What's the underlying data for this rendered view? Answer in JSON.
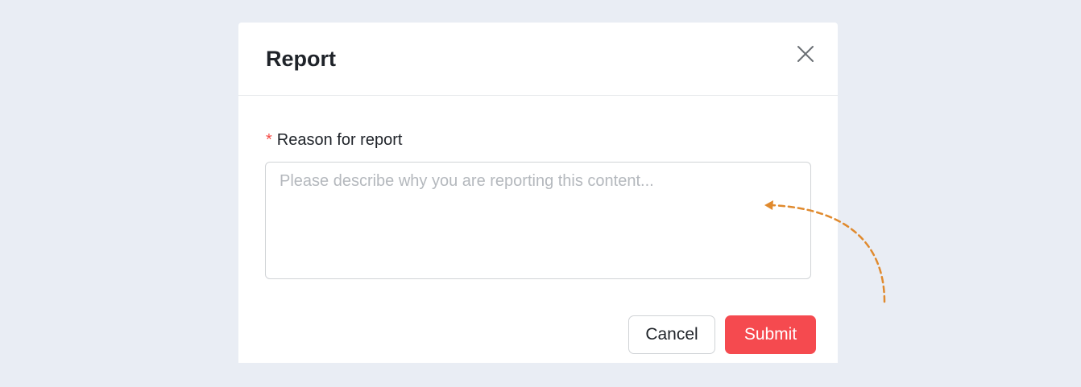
{
  "modal": {
    "title": "Report",
    "close_icon": "close-icon"
  },
  "form": {
    "required_mark": "*",
    "label": "Reason for report",
    "textarea": {
      "value": "",
      "placeholder": "Please describe why you are reporting this content..."
    }
  },
  "footer": {
    "cancel_label": "Cancel",
    "submit_label": "Submit"
  },
  "colors": {
    "background": "#e9edf4",
    "primary": "#f54a4f",
    "required": "#f54a45",
    "annotation_arrow": "#e08a2e"
  }
}
